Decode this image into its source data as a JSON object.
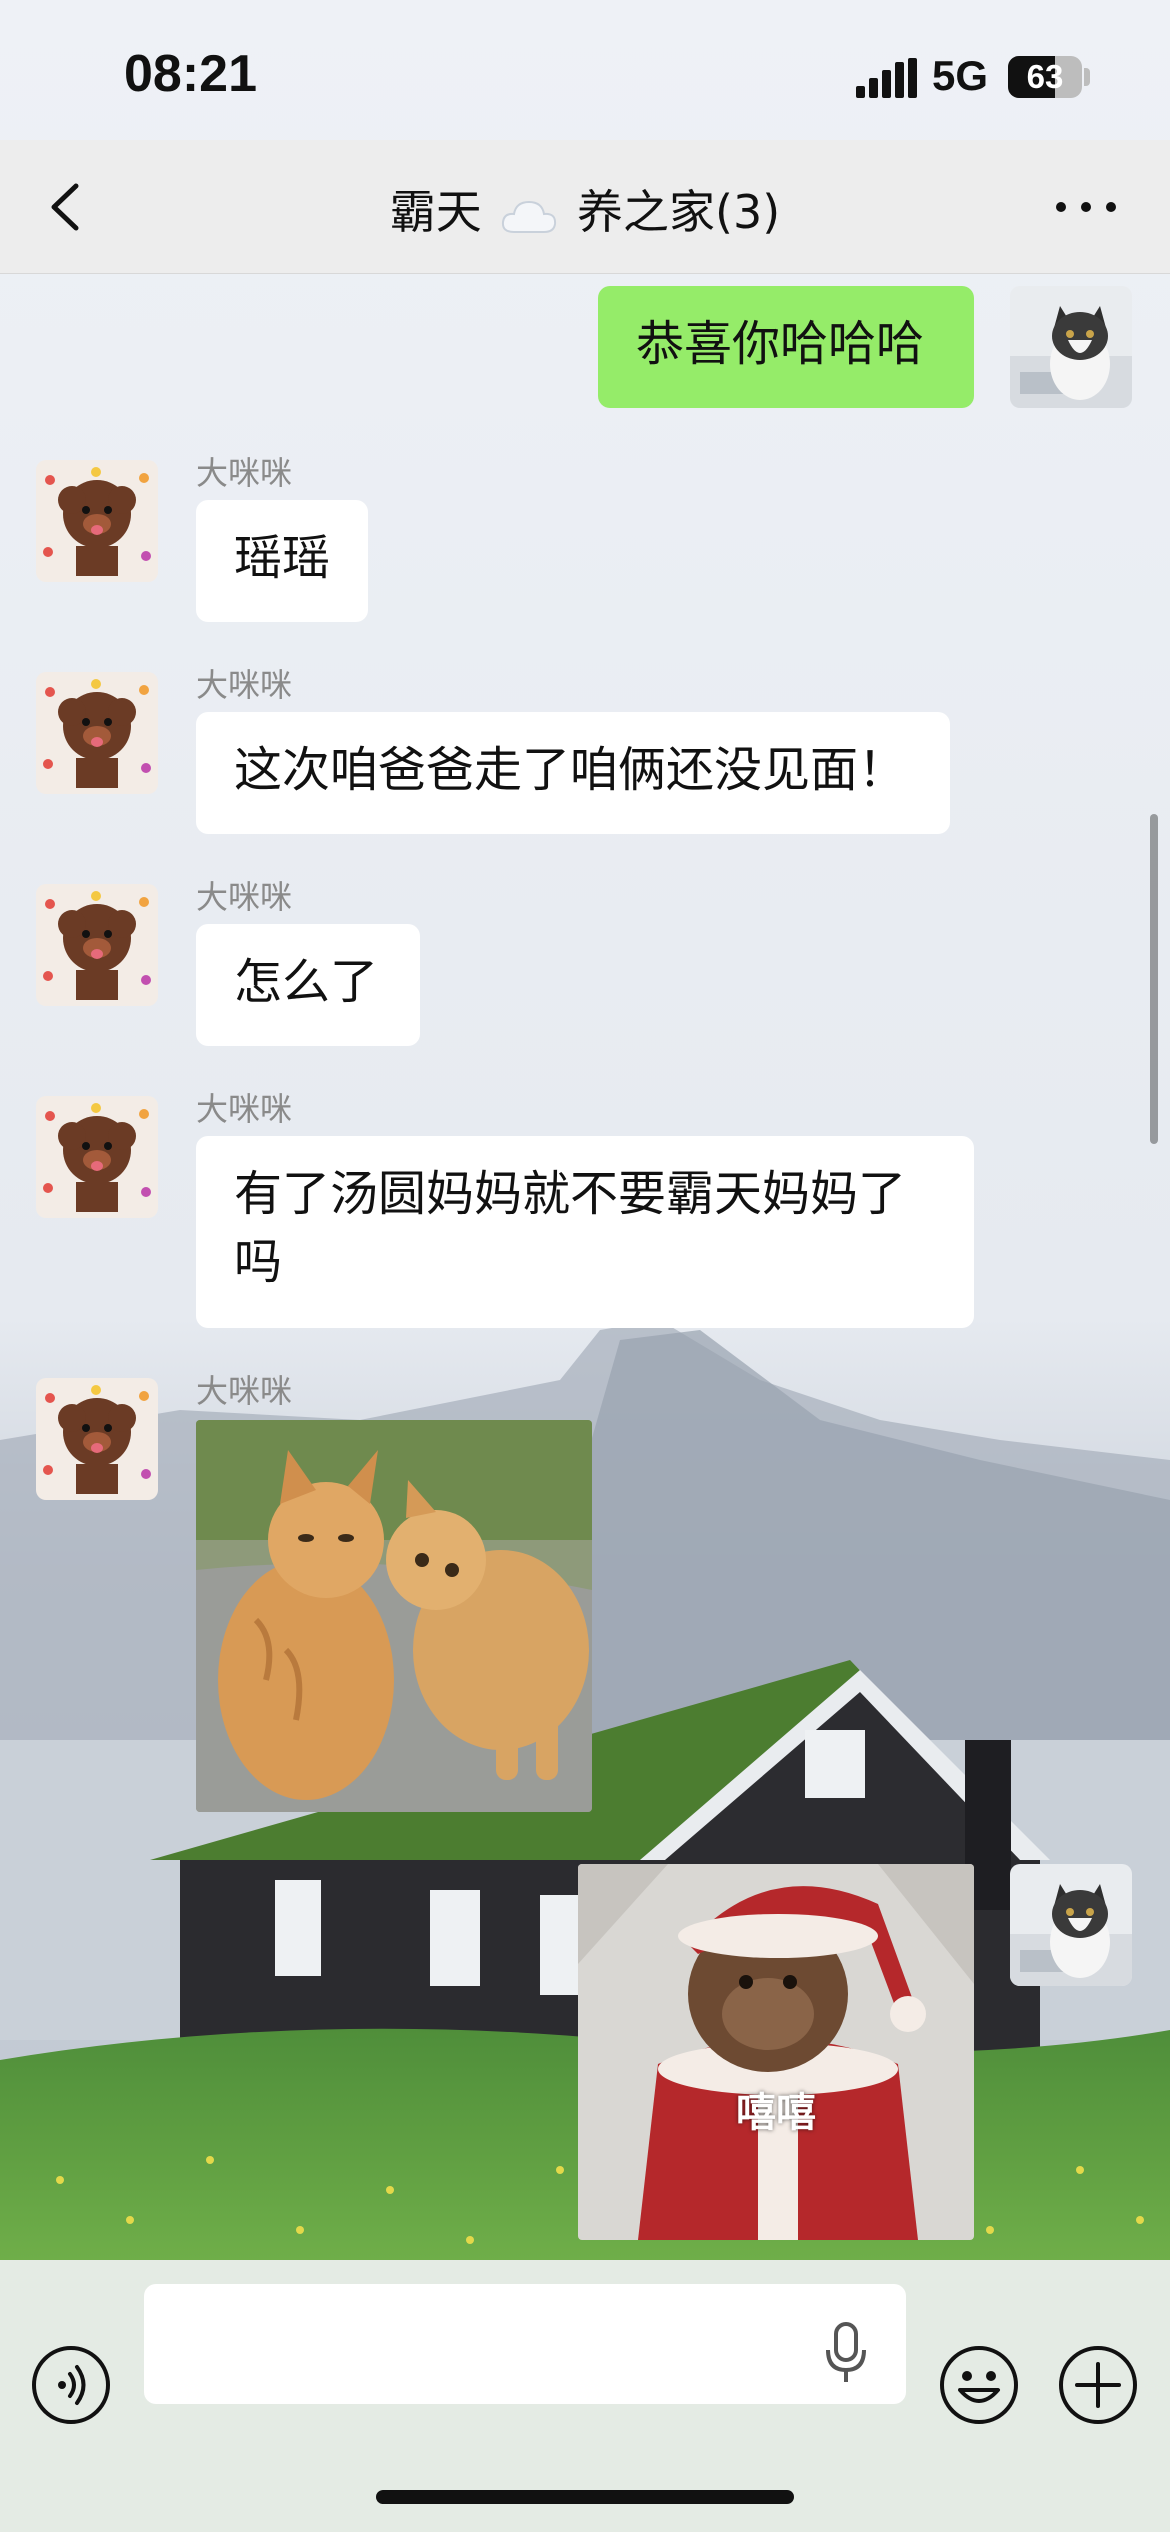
{
  "status_bar": {
    "time": "08:21",
    "network": "5G",
    "battery_level": "63",
    "battery_fraction": 0.63
  },
  "nav": {
    "title_part1": "霸天",
    "title_icon": "cloud-emoji",
    "title_part2": "养之家(3)",
    "back_icon": "chevron-left-icon",
    "more_icon": "more-dots-icon"
  },
  "messages": [
    {
      "side": "out",
      "type": "text",
      "text": "恭喜你哈哈哈",
      "avatar": "cat-avatar"
    },
    {
      "side": "in",
      "type": "text",
      "sender": "大咪咪",
      "text": "瑶瑶",
      "avatar": "poodle-avatar"
    },
    {
      "side": "in",
      "type": "text",
      "sender": "大咪咪",
      "text": "这次咱爸爸走了咱俩还没见面！",
      "avatar": "poodle-avatar"
    },
    {
      "side": "in",
      "type": "text",
      "sender": "大咪咪",
      "text": "怎么了",
      "avatar": "poodle-avatar"
    },
    {
      "side": "in",
      "type": "text",
      "sender": "大咪咪",
      "text_line1": "有了汤圆妈妈就不要霸天妈妈了",
      "text_line2": "吗",
      "avatar": "poodle-avatar"
    },
    {
      "side": "in",
      "type": "image",
      "sender": "大咪咪",
      "image": "two-orange-cats-photo",
      "avatar": "poodle-avatar"
    },
    {
      "side": "out",
      "type": "sticker",
      "image": "monkey-in-santa-suit-sticker",
      "caption": "嘻嘻",
      "avatar": "cat-avatar"
    }
  ],
  "input_bar": {
    "placeholder": "",
    "voice_icon": "voice-mode-icon",
    "mic_icon": "microphone-icon",
    "emoji_icon": "emoji-icon",
    "plus_icon": "plus-icon"
  },
  "colors": {
    "out_bubble": "#95ec69",
    "in_bubble": "#ffffff",
    "nav_bg": "#ededed",
    "sender_name": "#8a8a8a"
  }
}
